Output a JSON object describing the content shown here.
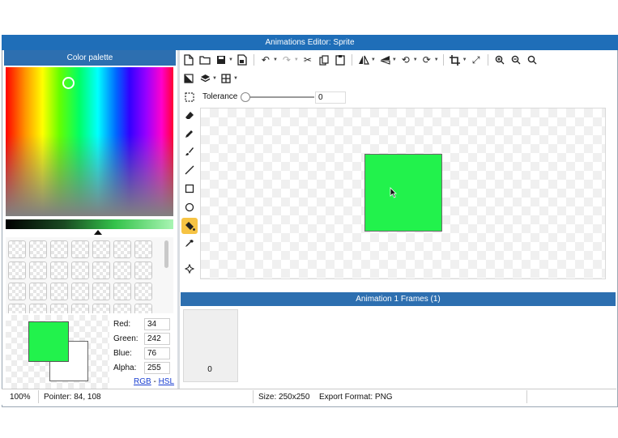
{
  "window": {
    "title": "Animations Editor: Sprite"
  },
  "palette": {
    "header": "Color palette",
    "components": [
      {
        "label": "Red:",
        "value": "34"
      },
      {
        "label": "Green:",
        "value": "242"
      },
      {
        "label": "Blue:",
        "value": "76"
      },
      {
        "label": "Alpha:",
        "value": "255"
      }
    ],
    "mode_rgb": "RGB",
    "mode_sep": "-",
    "mode_hsl": "HSL",
    "primary_color": "#22f24c",
    "secondary_color": "#ffffff"
  },
  "toolbar": {
    "row1": [
      "new-file-icon",
      "open-folder-icon",
      "save-icon",
      "save-as-icon",
      "undo-icon",
      "redo-icon",
      "cut-icon",
      "copy-icon",
      "paste-icon",
      "flip-horizontal-icon",
      "flip-vertical-icon",
      "rotate-left-icon",
      "rotate-right-icon",
      "crop-icon",
      "resize-icon",
      "zoom-in-icon",
      "zoom-out-icon",
      "zoom-reset-icon"
    ],
    "row2": [
      "fill-mode-icon",
      "layers-icon",
      "grid-icon"
    ],
    "tolerance_label": "Tolerance",
    "tolerance_value": "0",
    "tolerance_fraction": 0.0
  },
  "tools": [
    "eraser-icon",
    "pencil-icon",
    "brush-icon",
    "line-icon",
    "rectangle-icon",
    "ellipse-icon",
    "fill-bucket-icon",
    "eyedropper-icon",
    "move-icon"
  ],
  "active_tool": "fill-bucket-icon",
  "frames": {
    "header": "Animation 1 Frames (1)",
    "items": [
      {
        "index": "0"
      }
    ]
  },
  "status": {
    "zoom": "100%",
    "pointer": "Pointer: 84, 108",
    "size": "Size: 250x250",
    "export": "Export Format: PNG"
  }
}
